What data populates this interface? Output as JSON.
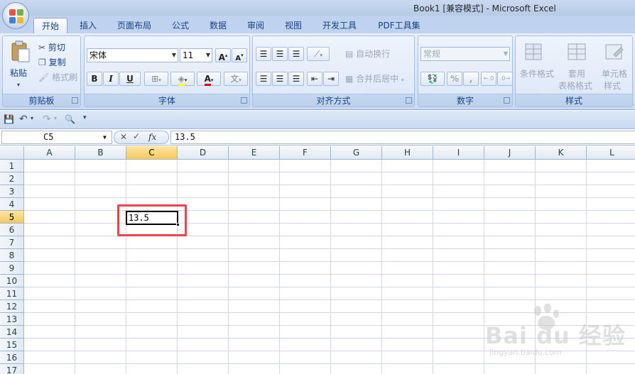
{
  "window": {
    "title": "Book1 [兼容模式] - Microsoft Excel"
  },
  "tabs": [
    "开始",
    "插入",
    "页面布局",
    "公式",
    "数据",
    "审阅",
    "视图",
    "开发工具",
    "PDF工具集"
  ],
  "active_tab": "开始",
  "ribbon": {
    "clipboard": {
      "label": "剪贴板",
      "paste": "粘贴",
      "cut": "剪切",
      "copy": "复制",
      "format_painter": "格式刷"
    },
    "font": {
      "label": "字体",
      "font_name": "宋体",
      "font_size": "11",
      "grow": "A",
      "shrink": "A",
      "bold": "B",
      "italic": "I",
      "underline": "U",
      "font_color_letter": "A",
      "phonetic": "文"
    },
    "alignment": {
      "label": "对齐方式",
      "wrap_text": "自动换行",
      "merge_center": "合并后居中"
    },
    "number": {
      "label": "数字",
      "format": "常规",
      "percent": "%",
      "comma": ","
    },
    "styles": {
      "label": "样式",
      "conditional": "条件格式",
      "table_format_1": "套用",
      "table_format_2": "表格格式",
      "cell_styles_1": "单元格",
      "cell_styles_2": "样式"
    }
  },
  "formula_bar": {
    "name_box": "C5",
    "content": "13.5"
  },
  "columns": [
    "A",
    "B",
    "C",
    "D",
    "E",
    "F",
    "G",
    "H",
    "I",
    "J",
    "K",
    "L"
  ],
  "rows": [
    "1",
    "2",
    "3",
    "4",
    "5",
    "6",
    "7",
    "8",
    "9",
    "10",
    "11",
    "12",
    "13",
    "14",
    "15",
    "16",
    "17"
  ],
  "selected_column": "C",
  "selected_row": "5",
  "active_cell": {
    "ref": "C5",
    "value": "13.5"
  },
  "watermark": {
    "brand": "Bai du 经验",
    "url": "jingyan.baidu.com"
  },
  "colors": {
    "accent": "#15428b",
    "highlight_box": "#e8454d",
    "selected_header": "#f8c85b"
  }
}
